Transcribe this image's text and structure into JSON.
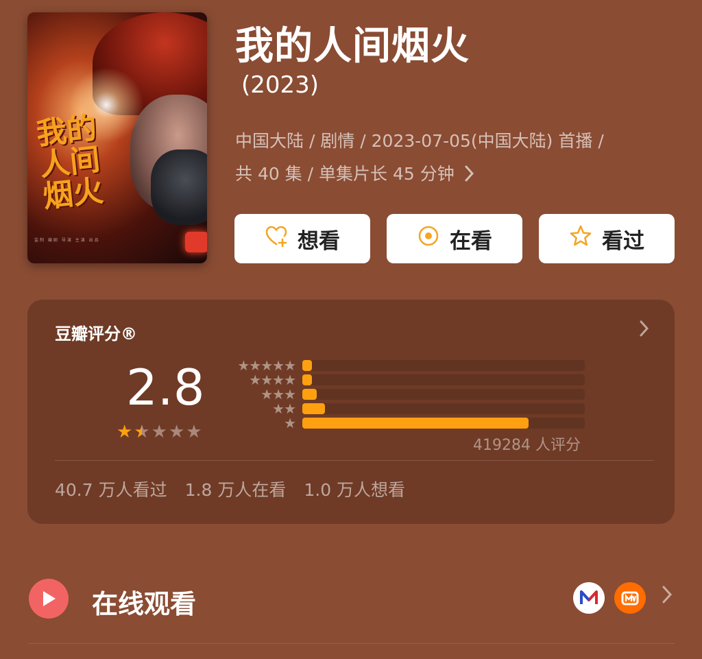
{
  "poster": {
    "calligraphy": "我的人间烟火",
    "credits": "监制 编剧 导演 主演 出品"
  },
  "title": "我的人间烟火",
  "year": "(2023)",
  "meta": {
    "line1": "中国大陆 / 剧情 / 2023-07-05(中国大陆) 首播 /",
    "line2": "共 40 集 / 单集片长 45 分钟",
    "more_icon": "chevron-right-icon"
  },
  "actions": {
    "want": "想看",
    "watching": "在看",
    "watched": "看过"
  },
  "rating": {
    "title": "豆瓣评分®",
    "score": "2.8",
    "score_stars": 1.5,
    "distribution": [
      {
        "stars": 5,
        "fraction": 0.03
      },
      {
        "stars": 4,
        "fraction": 0.03
      },
      {
        "stars": 3,
        "fraction": 0.05
      },
      {
        "stars": 2,
        "fraction": 0.08
      },
      {
        "stars": 1,
        "fraction": 0.8
      }
    ],
    "count_text": "419284 人评分",
    "stats": [
      "40.7 万人看过",
      "1.8 万人在看",
      "1.0 万人想看"
    ]
  },
  "watch": {
    "label": "在线观看",
    "platforms": [
      {
        "name": "migu-icon",
        "glyph": "M",
        "color": "#d9282f"
      },
      {
        "name": "mango-tv-icon",
        "glyph": "M",
        "color": "#ff6c00"
      }
    ]
  },
  "colors": {
    "background": "#8a4c33",
    "card": "#6f3b26",
    "accent": "#ffa010",
    "play": "#f26464"
  }
}
